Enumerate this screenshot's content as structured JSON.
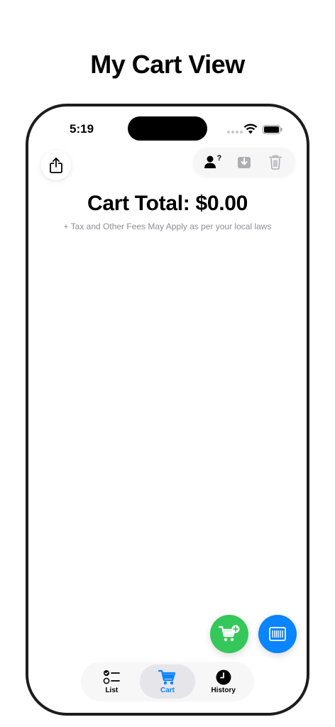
{
  "header": {
    "title": "My Cart View"
  },
  "status_bar": {
    "time": "5:19"
  },
  "cart": {
    "total": "Cart Total: $0.00",
    "note": "+ Tax and Other Fees May Apply as per your local laws"
  },
  "toolbar": {
    "share_icon": "share-icon",
    "user_help_icon": "person-question-icon",
    "download_icon": "download-icon",
    "trash_icon": "trash-icon"
  },
  "fabs": {
    "add_icon": "cart-plus-icon",
    "scan_icon": "barcode-icon",
    "add_color": "#34c759",
    "scan_color": "#0a84ff"
  },
  "tabs": [
    {
      "label": "List",
      "icon": "checklist-icon",
      "active": false
    },
    {
      "label": "Cart",
      "icon": "cart-icon",
      "active": true
    },
    {
      "label": "History",
      "icon": "clock-icon",
      "active": false
    }
  ],
  "colors": {
    "accent": "#0a84ff",
    "muted": "#8e8e93"
  }
}
